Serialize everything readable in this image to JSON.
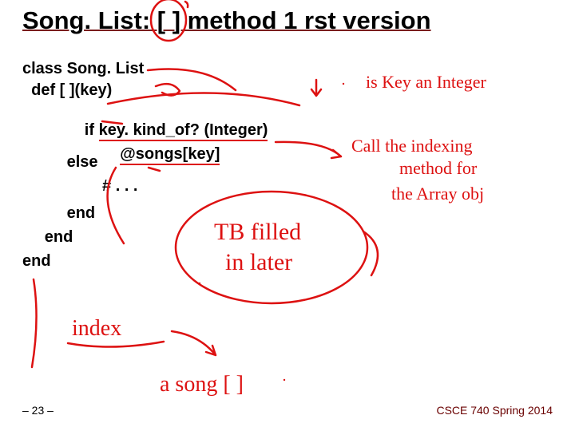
{
  "title": {
    "full": "Song. List: [ ] method 1 rst version"
  },
  "code": {
    "l1": "class Song. List",
    "l2": "  def [ ](key)",
    "l3_a": "          if ",
    "l3_b": "key. kind_of? (Integer)",
    "l4_a": "                  ",
    "l4_b": "@songs[key]",
    "l5": "          else",
    "l6": "                  # . . .",
    "l7": "          end",
    "l8": "     end",
    "l9": "end"
  },
  "annotations": {
    "a1": "is Key an Integer",
    "a2": "Call the indexing",
    "a3": "method for",
    "a4": "the Array obj",
    "a5": "TB filled",
    "a6": "in later",
    "a7": "index",
    "a8": "a song [ ]"
  },
  "footer": {
    "left": "– 23 –",
    "right": "CSCE 740 Spring 2014"
  }
}
